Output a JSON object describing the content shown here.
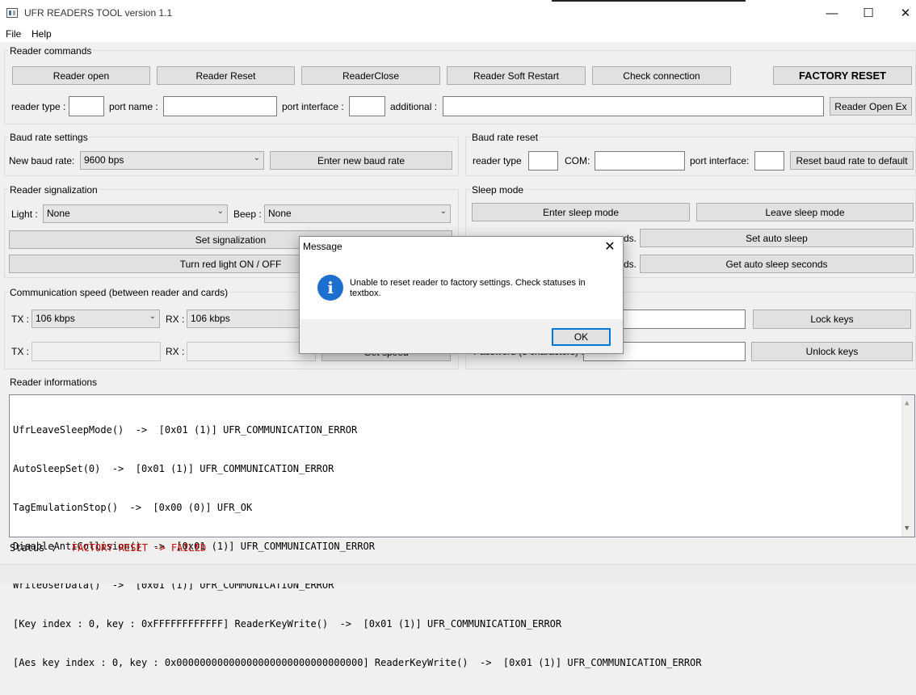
{
  "window": {
    "title": "UFR READERS TOOL version 1.1",
    "minimize_icon": "minimize-icon",
    "maximize_icon": "maximize-icon",
    "close_icon": "close-icon"
  },
  "menu": {
    "file": "File",
    "help": "Help"
  },
  "reader_commands": {
    "title": "Reader commands",
    "buttons": {
      "open": "Reader open",
      "reset": "Reader Reset",
      "close": "ReaderClose",
      "soft_restart": "Reader Soft Restart",
      "check_connection": "Check connection",
      "factory_reset": "FACTORY RESET",
      "open_ex": "Reader Open Ex"
    },
    "labels": {
      "reader_type": "reader type :",
      "port_name": "port name :",
      "port_interface": "port interface :",
      "additional": "additional :"
    }
  },
  "baud_settings": {
    "title": "Baud rate settings",
    "label": "New baud rate:",
    "selected": "9600 bps",
    "button": "Enter new baud rate"
  },
  "baud_reset": {
    "title": "Baud rate reset",
    "reader_type": "reader type",
    "com": "COM:",
    "port_interface": "port interface:",
    "button": "Reset baud rate to default"
  },
  "signalization": {
    "title": "Reader signalization",
    "light_label": "Light :",
    "light_value": "None",
    "beep_label": "Beep :",
    "beep_value": "None",
    "set_button": "Set signalization",
    "red_light_button": "Turn red light ON / OFF"
  },
  "sleep": {
    "title": "Sleep mode",
    "enter": "Enter sleep mode",
    "leave": "Leave sleep mode",
    "seconds_1": "ds.",
    "seconds_2": "ds.",
    "set_auto": "Set auto sleep",
    "get_auto": "Get auto sleep seconds"
  },
  "comm_speed": {
    "title": "Communication speed (between reader and cards)",
    "tx_label": "TX :",
    "tx_value": "106 kbps",
    "rx_label": "RX :",
    "rx_value": "106 kbps",
    "tx_label_2": "TX :",
    "rx_label_2": "RX :",
    "get_speed": "Get speed"
  },
  "keys": {
    "lock": "Lock keys",
    "unlock": "Unlock keys",
    "password_label": "Password (8 characters) :"
  },
  "info": {
    "title": "Reader informations",
    "lines": [
      "UfrLeaveSleepMode()  ->  [0x01 (1)] UFR_COMMUNICATION_ERROR",
      "AutoSleepSet(0)  ->  [0x01 (1)] UFR_COMMUNICATION_ERROR",
      "TagEmulationStop()  ->  [0x00 (0)] UFR_OK",
      "DisableAntiCollision()  ->  [0x01 (1)] UFR_COMMUNICATION_ERROR",
      "WriteUserData()  ->  [0x01 (1)] UFR_COMMUNICATION_ERROR",
      "[Key index : 0, key : 0xFFFFFFFFFFFF] ReaderKeyWrite()  ->  [0x01 (1)] UFR_COMMUNICATION_ERROR",
      "[Aes key index : 0, key : 0x00000000000000000000000000000000] ReaderKeyWrite()  ->  [0x01 (1)] UFR_COMMUNICATION_ERROR"
    ]
  },
  "status": {
    "label": "Status :",
    "value": "FACTORY RESET -> FAILED",
    "value_color": "#cc0000"
  },
  "dialog": {
    "title": "Message",
    "message": "Unable to reset reader to factory settings. Check statuses in textbox.",
    "ok": "OK",
    "icon": "info-icon"
  }
}
